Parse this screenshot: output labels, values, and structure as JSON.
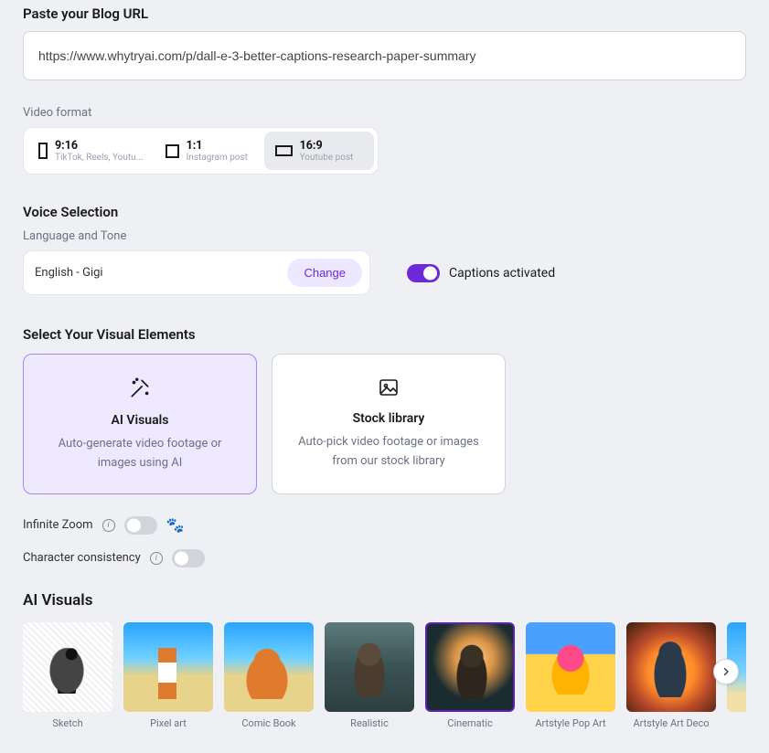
{
  "url_section": {
    "title": "Paste your Blog URL",
    "value": "https://www.whytryai.com/p/dall-e-3-better-captions-research-paper-summary"
  },
  "format_section": {
    "label": "Video format",
    "options": [
      {
        "title": "9:16",
        "sub": "TikTok, Reels, Youtu..."
      },
      {
        "title": "1:1",
        "sub": "Instagram post"
      },
      {
        "title": "16:9",
        "sub": "Youtube post"
      }
    ],
    "selected_index": 2
  },
  "voice_section": {
    "title": "Voice Selection",
    "subtitle": "Language and Tone",
    "current": "English - Gigi",
    "change_label": "Change",
    "captions_label": "Captions activated",
    "captions_on": true
  },
  "visuals_section": {
    "title": "Select Your Visual Elements",
    "cards": [
      {
        "title": "AI Visuals",
        "desc": "Auto-generate video footage or images using AI"
      },
      {
        "title": "Stock library",
        "desc": "Auto-pick video footage or images from our stock library"
      }
    ],
    "selected_card": 0
  },
  "options": {
    "infinite_zoom": {
      "label": "Infinite Zoom",
      "on": false
    },
    "character_consistency": {
      "label": "Character consistency",
      "on": false
    }
  },
  "gallery": {
    "title": "AI Visuals",
    "items": [
      {
        "label": "Sketch"
      },
      {
        "label": "Pixel art"
      },
      {
        "label": "Comic Book"
      },
      {
        "label": "Realistic"
      },
      {
        "label": "Cinematic"
      },
      {
        "label": "Artstyle Pop Art"
      },
      {
        "label": "Artstyle Art Deco"
      }
    ],
    "selected_index": 4
  }
}
